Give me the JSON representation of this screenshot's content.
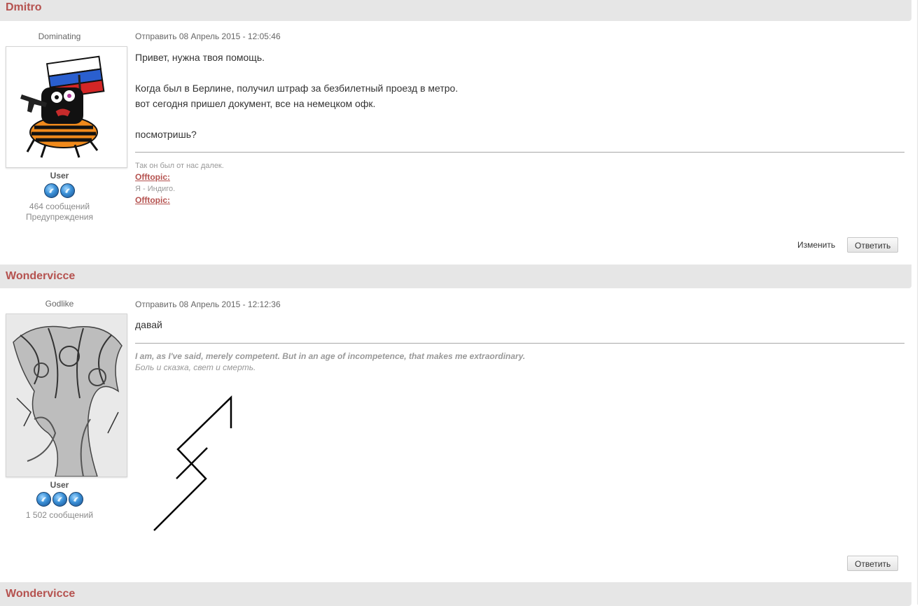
{
  "posts": [
    {
      "author": "Dmitro",
      "rank": "Dominating",
      "group": "User",
      "badge_count": 2,
      "message_count": "464 сообщений",
      "warnings": "Предупреждения",
      "date": "Отправить 08 Апрель 2015 - 12:05:46",
      "body": [
        "Привет, нужна твоя помощь.",
        "",
        "Когда был в Берлине, получил штраф за безбилетный проезд в метро.",
        "вот сегодня пришел документ, все на немецком офк.",
        "",
        "посмотришь?"
      ],
      "signature": {
        "line1": "Так он был от нас далек.",
        "offtopic1": "Offtopic:",
        "line2": "Я - Индиго.",
        "offtopic2": "Offtopic:"
      },
      "edit_label": "Изменить",
      "reply_label": "Ответить"
    },
    {
      "author": "Wondervicce",
      "rank": "Godlike",
      "group": "User",
      "badge_count": 3,
      "message_count": "1 502 сообщений",
      "date": "Отправить 08 Апрель 2015 - 12:12:36",
      "body": [
        "давай"
      ],
      "signature": {
        "quote": "I am, as I've said, merely competent. But in an age of incompetence, that makes me extraordinary.",
        "line": "Боль и сказка, свет и смерть."
      },
      "reply_label": "Ответить"
    },
    {
      "author": "Wondervicce"
    }
  ],
  "colors": {
    "author": "#b5524f",
    "header_bg": "#e6e6e6"
  }
}
